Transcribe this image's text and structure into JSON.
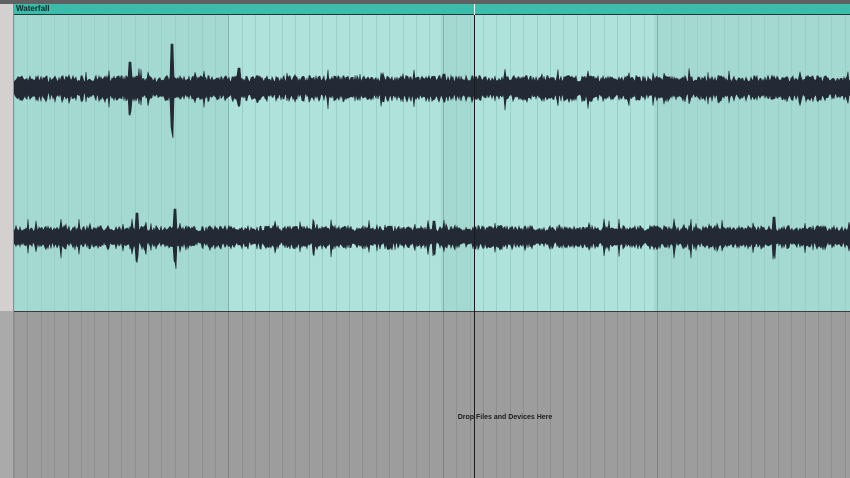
{
  "clip": {
    "name": "Waterfall",
    "color": "#3cbcab",
    "body_color": "#a8ddd6"
  },
  "drop_zone": {
    "label": "Drop Files and Devices Here"
  },
  "waveform": {
    "color": "#232a35",
    "channels": [
      "left",
      "right"
    ]
  }
}
